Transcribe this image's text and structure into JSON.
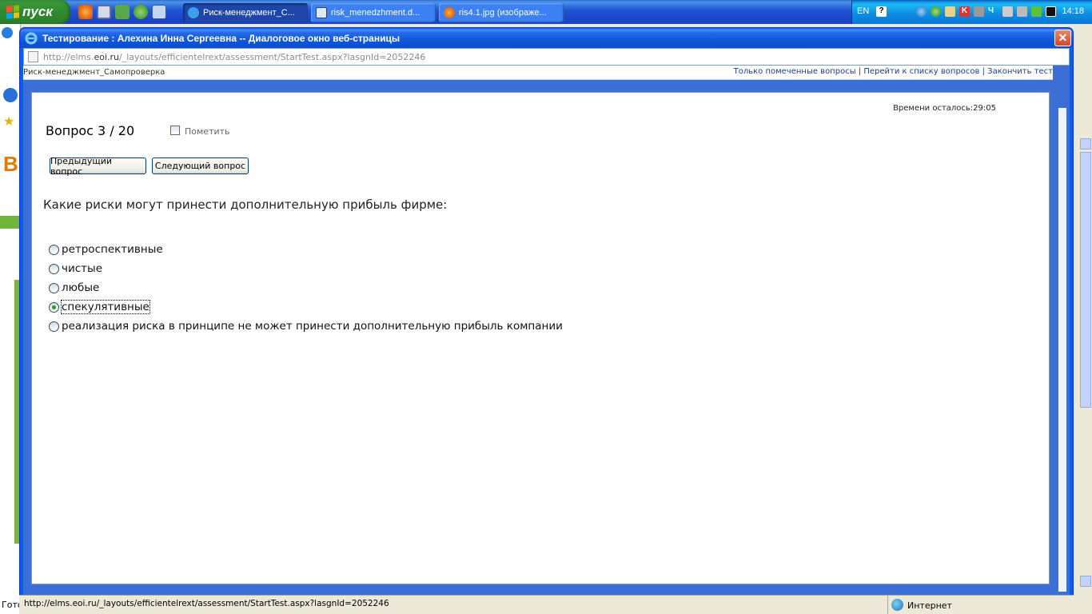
{
  "taskbar": {
    "start_label": "пуск",
    "tasks": [
      {
        "label": "Риск-менеджмент_С..."
      },
      {
        "label": "risk_menedzhment.d..."
      },
      {
        "label": "ris4.1.jpg (изображе..."
      }
    ],
    "lang": "EN",
    "clock": "14:18"
  },
  "dialog": {
    "title": "Тестирование : Алехина Инна Сергеевна -- Диалоговое окно веб-страницы",
    "address_prefix": "http://elms.",
    "address_host": "eoi.ru",
    "address_rest": "/_layouts/efficientelrext/assessment/StartTest.aspx?lasgnId=2052246",
    "close_label": "✕"
  },
  "topbar": {
    "course": "Риск-менеджмент_Самопроверка",
    "link_flagged": "Только помеченные вопросы",
    "link_list": "Перейти к списку вопросов",
    "link_finish": "Закончить тест",
    "separator": " | "
  },
  "test": {
    "timer": "Времени осталось:29:05",
    "question_number": "Вопрос 3 / 20",
    "mark_label": "Пометить",
    "prev_button": "Предыдущий вопрос",
    "next_button": "Следующий вопрос",
    "question": "Какие риски могут принести дополнительную прибыль фирме:",
    "options": [
      {
        "label": "ретроспективные",
        "selected": false
      },
      {
        "label": "чистые",
        "selected": false
      },
      {
        "label": "любые",
        "selected": false
      },
      {
        "label": "спекулятивные",
        "selected": true
      },
      {
        "label": "реализация риска в принципе не может принести дополнительную прибыль компании",
        "selected": false
      }
    ]
  },
  "status": {
    "url": "http://elms.eoi.ru/_layouts/efficientelrext/assessment/StartTest.aspx?lasgnId=2052246",
    "zone": "Интернет"
  },
  "background_window": {
    "status_partial": "Гото"
  },
  "colors": {
    "xp_blue": "#0b5fe0",
    "start_green": "#2f8a2f",
    "radio_selected": "#21a121"
  }
}
